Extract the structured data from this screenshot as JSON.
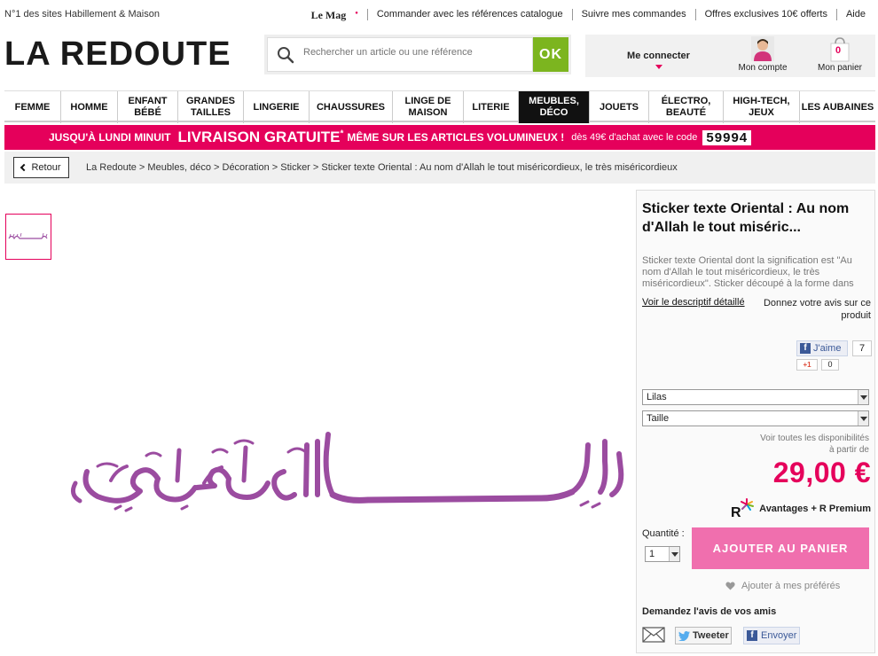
{
  "topbar": {
    "tagline": "N°1 des sites Habillement & Maison",
    "lemag": "Le Mag",
    "links": [
      "Commander avec les références catalogue",
      "Suivre mes commandes",
      "Offres exclusives 10€ offerts",
      "Aide"
    ]
  },
  "header": {
    "logo": "LA REDOUTE",
    "search_placeholder": "Rechercher un article ou une référence",
    "search_button": "OK",
    "connect_label": "Me connecter",
    "account_label": "Mon compte",
    "cart_label": "Mon panier",
    "cart_count": "0"
  },
  "nav": {
    "items": [
      {
        "label": "FEMME"
      },
      {
        "label": "HOMME"
      },
      {
        "label": "ENFANT BÉBÉ"
      },
      {
        "label": "GRANDES TAILLES"
      },
      {
        "label": "LINGERIE"
      },
      {
        "label": "CHAUSSURES"
      },
      {
        "label": "LINGE DE MAISON"
      },
      {
        "label": "LITERIE"
      },
      {
        "label": "MEUBLES, DÉCO",
        "active": true
      },
      {
        "label": "JOUETS"
      },
      {
        "label": "ÉLECTRO, BEAUTÉ"
      },
      {
        "label": "HIGH-TECH, JEUX"
      },
      {
        "label": "LES AUBAINES"
      }
    ]
  },
  "promo": {
    "part1": "JUSQU'À LUNDI MINUIT",
    "part2": "LIVRAISON GRATUITE",
    "star": "*",
    "part3": "MÊME SUR LES ARTICLES VOLUMINEUX !",
    "part4": "dès 49€ d'achat avec le code",
    "code": "59994"
  },
  "breadcrumb": {
    "back": "Retour",
    "path": "La Redoute > Meubles, déco > Décoration > Sticker > Sticker texte Oriental : Au nom d'Allah le tout miséricordieux, le très miséricordieux"
  },
  "product": {
    "title": "Sticker texte Oriental : Au nom d'Allah le tout miséric...",
    "description": "Sticker texte Oriental dont la signification est \"Au nom d'Allah le tout miséricordieux, le très miséricordieux\". Sticker découpé à la forme dans",
    "detail_link": "Voir le descriptif détaillé",
    "review_link": "Donnez votre avis sur ce produit",
    "fb_like": "J'aime",
    "fb_count": "7",
    "gplus": "+1",
    "gplus_count": "0",
    "color_select": "Lilas",
    "size_select": "Taille",
    "availability": "Voir toutes les disponibilités",
    "price_from": "à partir de",
    "price": "29,00 €",
    "premium": "Avantages + R Premium",
    "qty_label": "Quantité :",
    "qty_value": "1",
    "add_to_cart": "AJOUTER AU PANIER",
    "favorites": "Ajouter à mes préférés",
    "ask_opinion": "Demandez l'avis de vos amis",
    "tweet": "Tweeter",
    "send": "Envoyer"
  },
  "colors": {
    "brand_pink": "#e5005b",
    "cart_button": "#f06fae",
    "search_ok": "#7cb51f",
    "calligraphy": "#9b4ca0"
  }
}
